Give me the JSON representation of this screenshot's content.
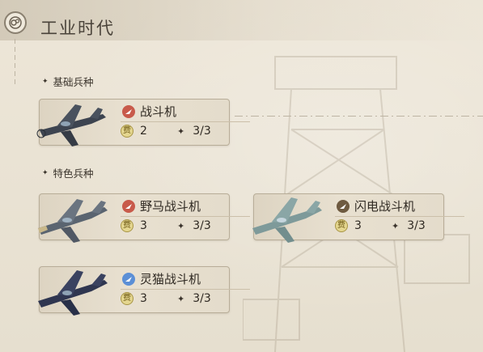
{
  "header": {
    "title": "工业时代"
  },
  "sections": {
    "basic": {
      "label": "基础兵种"
    },
    "special": {
      "label": "特色兵种"
    }
  },
  "colors": {
    "red_badge": "#c85a4a",
    "brown_badge": "#6e5a40",
    "blue_badge": "#5b8fd6",
    "cost_coin": "#e4d68f"
  },
  "units": [
    {
      "name": "战斗机",
      "badge": "red-wing-icon",
      "cost_label": "费",
      "cost": "2",
      "count": "3/3"
    },
    {
      "name": "野马战斗机",
      "badge": "red-wing-icon",
      "cost_label": "费",
      "cost": "3",
      "count": "3/3"
    },
    {
      "name": "闪电战斗机",
      "badge": "brown-wing-icon",
      "cost_label": "费",
      "cost": "3",
      "count": "3/3"
    },
    {
      "name": "灵猫战斗机",
      "badge": "blue-wing-icon",
      "cost_label": "费",
      "cost": "3",
      "count": "3/3"
    }
  ]
}
